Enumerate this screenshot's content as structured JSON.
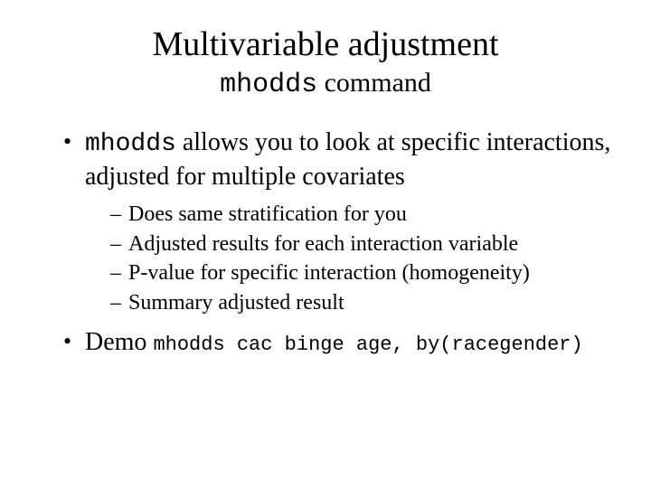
{
  "title": "Multivariable adjustment",
  "subtitle_code": "mhodds",
  "subtitle_rest": " command",
  "bullets": {
    "b1_code": "mhodds",
    "b1_rest": " allows you to look at specific interactions, adjusted for multiple covariates",
    "b1_sub": {
      "s1": "Does same stratification for you",
      "s2": "Adjusted results for each interaction variable",
      "s3": "P-value for specific interaction (homogeneity)",
      "s4": "Summary adjusted result"
    },
    "b2_label": "Demo ",
    "b2_cmd": "mhodds cac binge age, by(racegender)"
  }
}
